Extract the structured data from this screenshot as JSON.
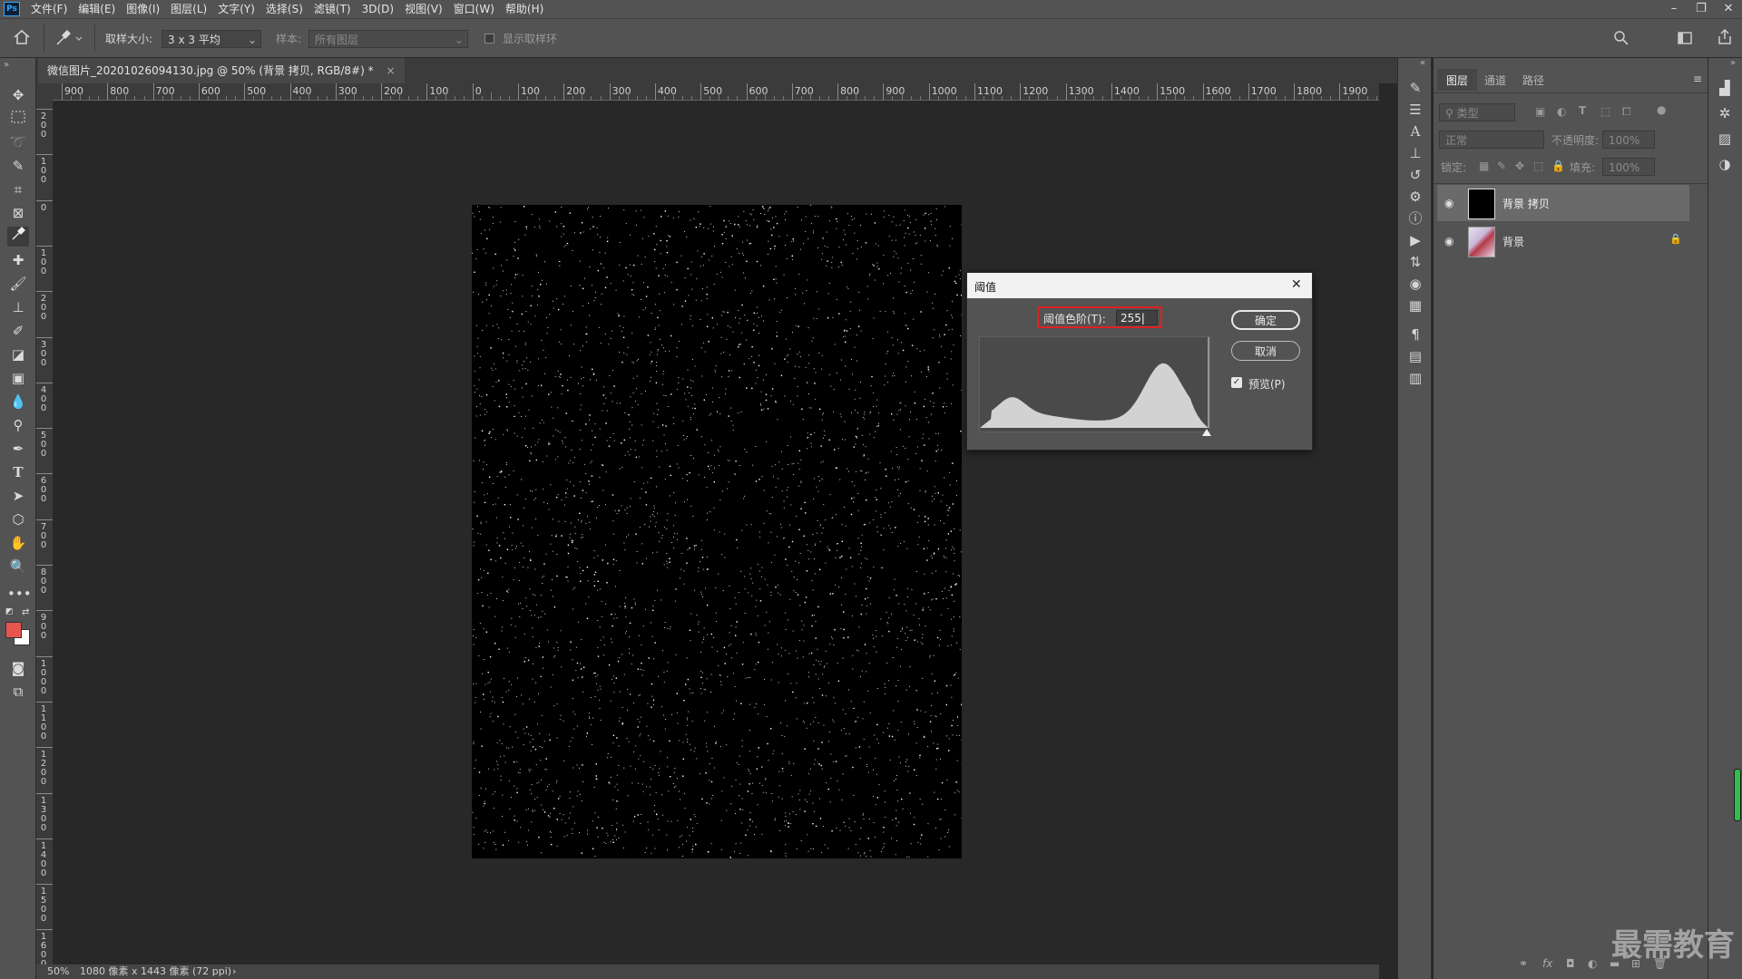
{
  "app": {
    "logo": "Ps"
  },
  "menu": [
    "文件(F)",
    "编辑(E)",
    "图像(I)",
    "图层(L)",
    "文字(Y)",
    "选择(S)",
    "滤镜(T)",
    "3D(D)",
    "视图(V)",
    "窗口(W)",
    "帮助(H)"
  ],
  "window_controls": {
    "minimize": "–",
    "restore": "❐",
    "close": "✕"
  },
  "options": {
    "sample_size_label": "取样大小:",
    "sample_size_value": "3 x 3 平均",
    "sample_label": "样本:",
    "sample_value": "所有图层",
    "show_ring_label": "显示取样环"
  },
  "document": {
    "tab_title": "微信图片_20201026094130.jpg @ 50% (背景 拷贝, RGB/8#) *",
    "tab_close": "×"
  },
  "ruler": {
    "h_labels": [
      "900",
      "800",
      "700",
      "600",
      "500",
      "400",
      "300",
      "200",
      "100",
      "0",
      "100",
      "200",
      "300",
      "400",
      "500",
      "600",
      "700",
      "800",
      "900",
      "1000",
      "1100",
      "1200",
      "1300",
      "1400",
      "1500",
      "1600",
      "1700",
      "1800",
      "1900"
    ],
    "v_labels": [
      "2\n0\n0",
      "1\n0\n0",
      "0",
      "1\n0\n0",
      "2\n0\n0",
      "3\n0\n0",
      "4\n0\n0",
      "5\n0\n0",
      "6\n0\n0",
      "7\n0\n0",
      "8\n0\n0",
      "9\n0\n0",
      "1\n0\n0\n0",
      "1\n1\n0\n0",
      "1\n2\n0\n0",
      "1\n3\n0\n0",
      "1\n4\n0\n0",
      "1\n5\n0\n0",
      "1\n6\n0\n0"
    ]
  },
  "status": {
    "zoom": "50%",
    "info": "1080 像素 x 1443 像素 (72 ppi)",
    "arrow": "›"
  },
  "panel": {
    "tabs": [
      "图层",
      "通道",
      "路径"
    ],
    "filter_placeholder": "类型",
    "blend_mode": "正常",
    "opacity_label": "不透明度:",
    "opacity_value": "100%",
    "lock_label": "锁定:",
    "fill_label": "填充:",
    "fill_value": "100%",
    "layers": [
      {
        "name": "背景 拷贝",
        "selected": true,
        "locked": false
      },
      {
        "name": "背景",
        "selected": false,
        "locked": true
      }
    ]
  },
  "dialog": {
    "title": "阈值",
    "close": "✕",
    "level_label": "阈值色阶(T):",
    "level_value": "255",
    "ok": "确定",
    "cancel": "取消",
    "preview_label": "预览(P)",
    "preview_checked": true
  },
  "colors": {
    "foreground": "#e8554e",
    "background": "#ffffff",
    "highlight_box": "#e02020",
    "histogram_fill": "#d2d2d2"
  },
  "watermark": "最需教育"
}
